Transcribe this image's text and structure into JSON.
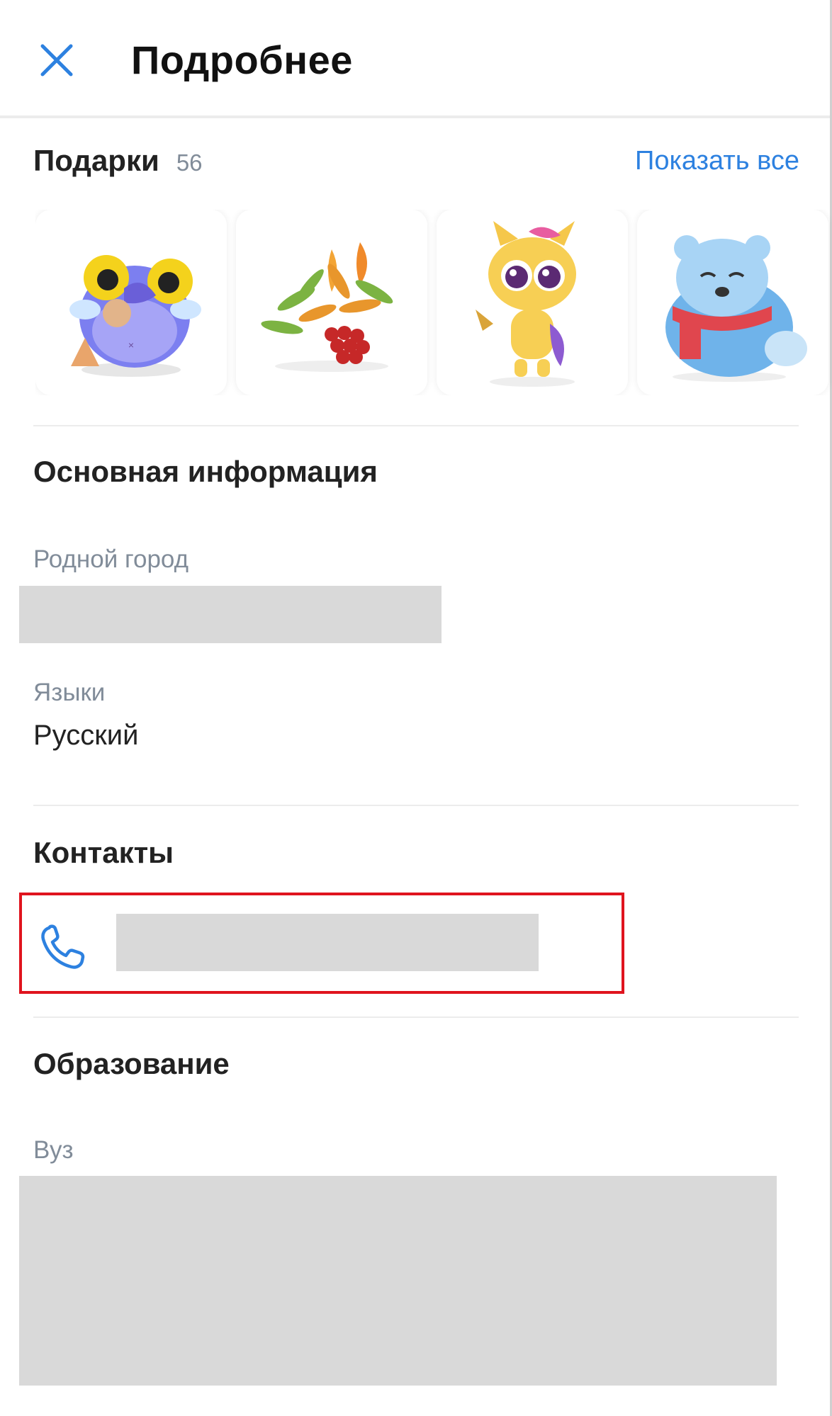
{
  "header": {
    "title": "Подробнее",
    "close_icon": "close-icon"
  },
  "gifts": {
    "title": "Подарки",
    "count": "56",
    "show_all_label": "Показать все",
    "items": [
      {
        "icon": "gift-sticker-blue-monster"
      },
      {
        "icon": "gift-sticker-rowan-branch"
      },
      {
        "icon": "gift-sticker-cat"
      },
      {
        "icon": "gift-sticker-blue-bear"
      }
    ]
  },
  "basic_info": {
    "title": "Основная информация",
    "hometown_label": "Родной город",
    "languages_label": "Языки",
    "languages_value": "Русский"
  },
  "contacts": {
    "title": "Контакты",
    "phone_icon": "phone-icon",
    "highlight_color": "#e0141e"
  },
  "education": {
    "title": "Образование",
    "university_label": "Вуз"
  },
  "colors": {
    "accent": "#2d81e0",
    "secondary_text": "#818c99",
    "redaction": "#d9d9d9"
  }
}
